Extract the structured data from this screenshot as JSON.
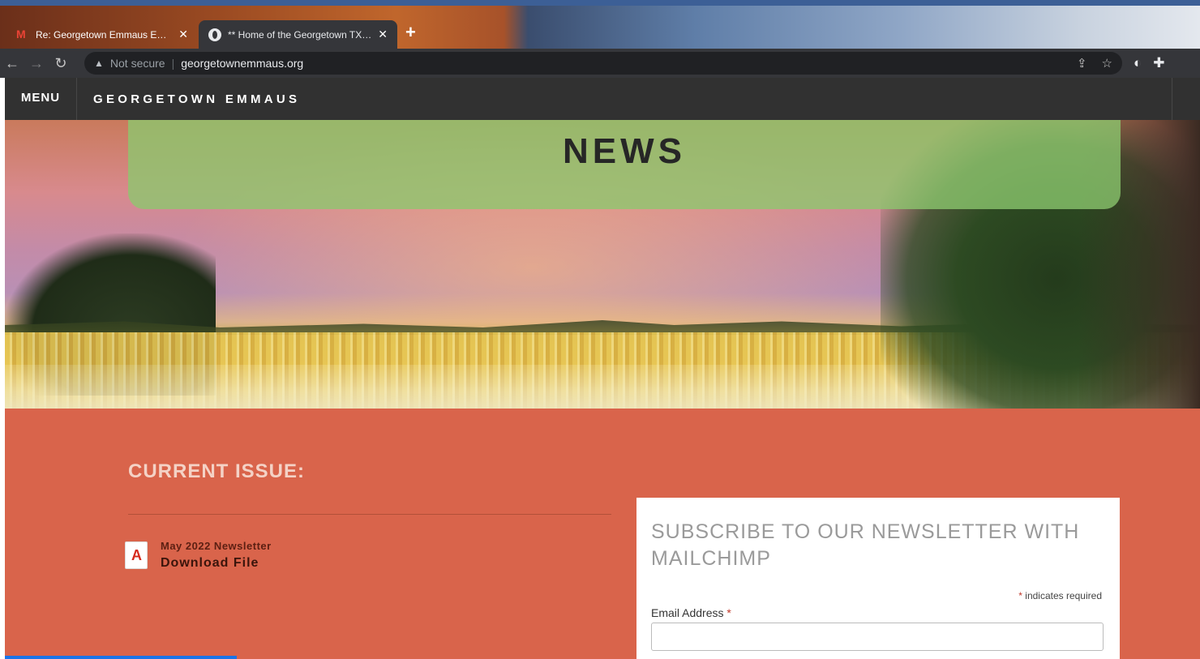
{
  "browser": {
    "tabs": [
      {
        "title": "Re: Georgetown Emmaus Email",
        "icon": "gmail-icon",
        "active": false
      },
      {
        "title": "** Home of the Georgetown TX Emmaus",
        "icon": "globe-icon",
        "active": true
      }
    ],
    "new_tab": "+",
    "close_glyph": "✕",
    "security_label": "Not secure",
    "url": "georgetownemmaus.org"
  },
  "site": {
    "menu_label": "MENU",
    "brand": "GEORGETOWN EMMAUS"
  },
  "hero": {
    "title": "NEWS"
  },
  "current_issue": {
    "heading": "CURRENT ISSUE:",
    "file_name": "May 2022 Newsletter",
    "download_label": "Download File"
  },
  "subscribe": {
    "heading": "SUBSCRIBE TO OUR NEWSLETTER WITH MAILCHIMP",
    "required_star": "*",
    "required_note": " indicates required",
    "email_label": "Email Address ",
    "email_star": "*"
  },
  "colors": {
    "content_bg": "#d9644b",
    "nav_bg": "#313131",
    "banner": "#8cc86e"
  }
}
